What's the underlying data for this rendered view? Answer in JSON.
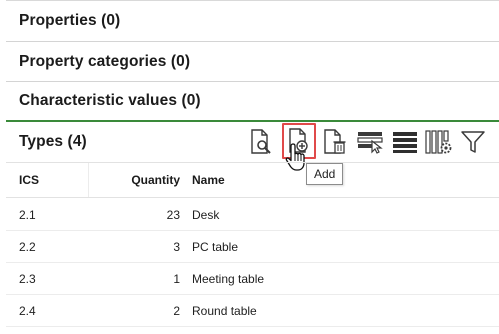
{
  "sections": {
    "properties": "Properties (0)",
    "property_categories": "Property categories (0)",
    "characteristic_values": "Characteristic values (0)"
  },
  "types": {
    "title": "Types (4)",
    "toolbar": {
      "view_icon": "document-magnifier-icon",
      "add_icon": "document-add-icon",
      "delete_icon": "document-delete-icon",
      "select_icon": "row-select-cursor-icon",
      "list_icon": "list-rows-icon",
      "columns_icon": "columns-settings-icon",
      "filter_icon": "filter-funnel-icon"
    },
    "tooltip": "Add",
    "columns": {
      "ics": "ICS",
      "quantity": "Quantity",
      "name": "Name"
    },
    "rows": [
      {
        "ics": "2.1",
        "quantity": "23",
        "name": "Desk"
      },
      {
        "ics": "2.2",
        "quantity": "3",
        "name": "PC table"
      },
      {
        "ics": "2.3",
        "quantity": "1",
        "name": "Meeting table"
      },
      {
        "ics": "2.4",
        "quantity": "2",
        "name": "Round table"
      }
    ]
  },
  "colors": {
    "accent_green": "#3a8a3a",
    "highlight_red": "#e04a4a",
    "icon_dark": "#3a3a3a"
  }
}
